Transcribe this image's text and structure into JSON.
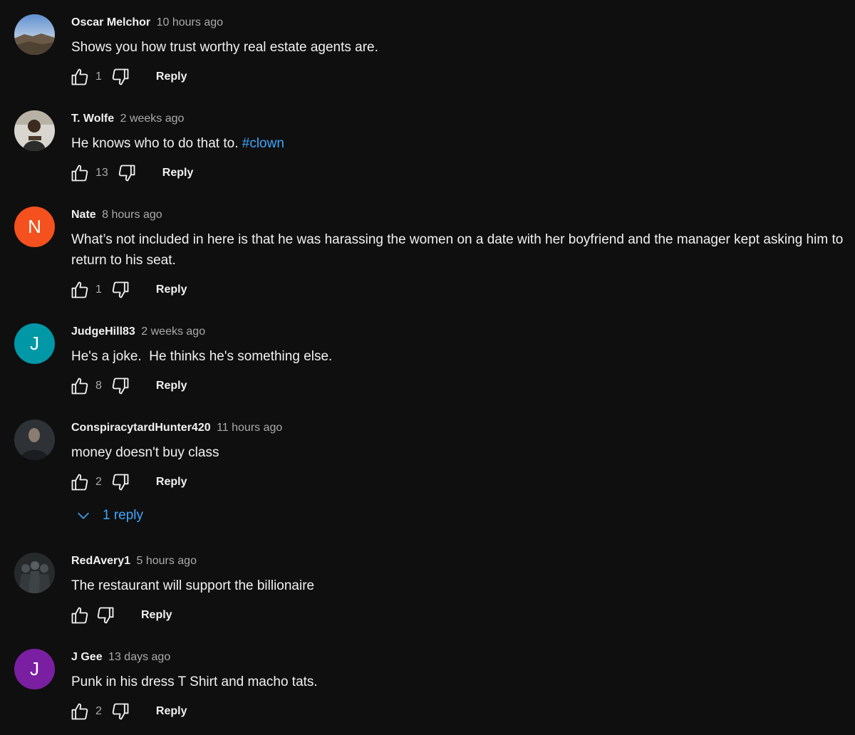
{
  "comments": [
    {
      "author": "Oscar Melchor",
      "time": "10 hours ago",
      "text": "Shows you how trust worthy real estate agents are.",
      "likes": "1",
      "reply_label": "Reply",
      "avatar": {
        "type": "photo",
        "icon": "landscape-photo-avatar"
      }
    },
    {
      "author": "T. Wolfe",
      "time": "2 weeks ago",
      "text": "He knows who to do that to.",
      "hashtag": "#clown",
      "likes": "13",
      "reply_label": "Reply",
      "avatar": {
        "type": "photo",
        "icon": "person-photo-avatar"
      }
    },
    {
      "author": "Nate",
      "time": "8 hours ago",
      "text": "What’s not included in here is that he was harassing the women on a date with her boyfriend and the manager kept asking him to return to his seat.",
      "likes": "1",
      "reply_label": "Reply",
      "avatar": {
        "type": "letter",
        "letter": "N",
        "color": "#f4511e"
      }
    },
    {
      "author": "JudgeHill83",
      "time": "2 weeks ago",
      "text": "He's a joke.  He thinks he's something else.",
      "likes": "8",
      "reply_label": "Reply",
      "avatar": {
        "type": "letter",
        "letter": "J",
        "color": "#0097a7"
      }
    },
    {
      "author": "ConspiracytardHunter420",
      "time": "11 hours ago",
      "text": "money doesn't buy class",
      "likes": "2",
      "reply_label": "Reply",
      "avatar": {
        "type": "photo",
        "icon": "person-photo-avatar"
      },
      "replies_label": "1 reply"
    },
    {
      "author": "RedAvery1",
      "time": "5 hours ago",
      "text": "The restaurant will support the billionaire",
      "likes": "",
      "reply_label": "Reply",
      "avatar": {
        "type": "photo",
        "icon": "group-photo-avatar"
      }
    },
    {
      "author": "J Gee",
      "time": "13 days ago",
      "text": "Punk in his dress T Shirt and macho tats.",
      "likes": "2",
      "reply_label": "Reply",
      "avatar": {
        "type": "letter",
        "letter": "J",
        "color": "#7b1fa2"
      }
    }
  ],
  "colors": {
    "background": "#0f0f0f",
    "link": "#3ea6ff",
    "secondary_text": "#aaaaaa"
  }
}
